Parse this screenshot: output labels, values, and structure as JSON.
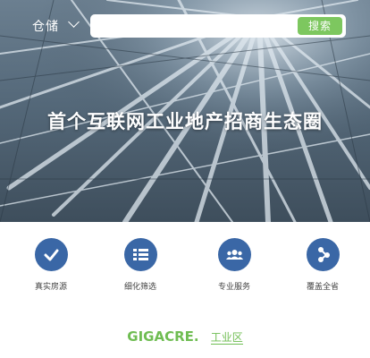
{
  "header": {
    "city": "仓储",
    "search": {
      "placeholder": "",
      "button_label": "搜索"
    }
  },
  "hero": {
    "slogan": "首个互联网工业地产招商生态圈"
  },
  "features": [
    {
      "label": "真实房源",
      "icon": "check-icon"
    },
    {
      "label": "细化筛选",
      "icon": "list-icon"
    },
    {
      "label": "专业服务",
      "icon": "group-icon"
    },
    {
      "label": "覆盖全省",
      "icon": "share-icon"
    }
  ],
  "footer": {
    "brand": "GIGACRE.",
    "sub": "工业区"
  },
  "colors": {
    "accent_green": "#7dc75f",
    "icon_blue": "#3a67a6"
  }
}
